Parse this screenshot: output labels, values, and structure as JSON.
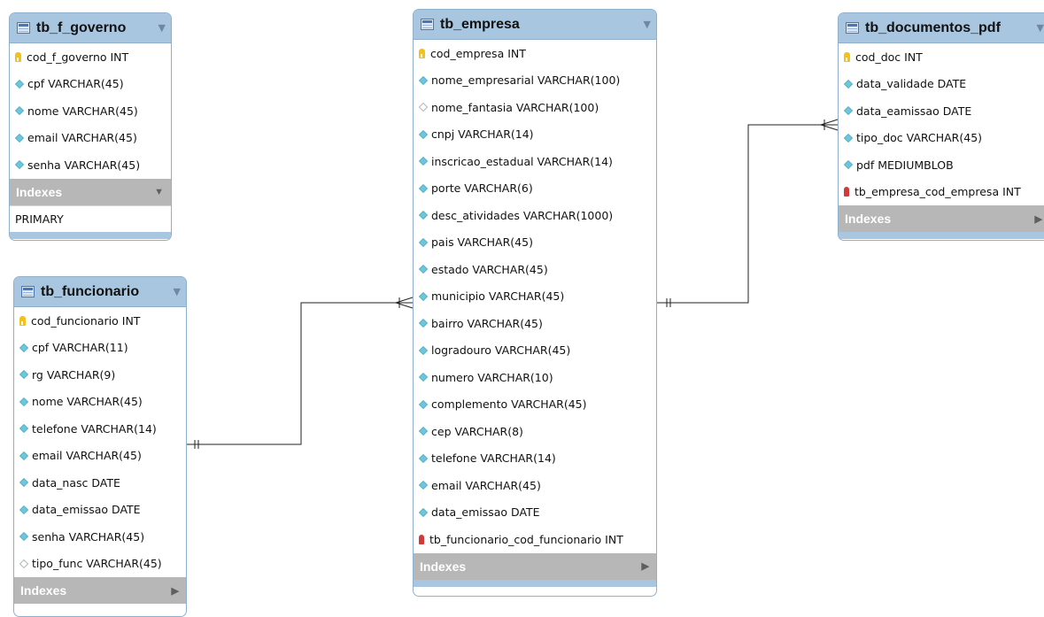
{
  "tables": {
    "tb_f_governo": {
      "title": "tb_f_governo",
      "columns": [
        {
          "label": "cod_f_governo INT",
          "icon": "primary-key-icon"
        },
        {
          "label": "cpf VARCHAR(45)",
          "icon": "diamond-filled-icon"
        },
        {
          "label": "nome VARCHAR(45)",
          "icon": "diamond-filled-icon"
        },
        {
          "label": "email VARCHAR(45)",
          "icon": "diamond-filled-icon"
        },
        {
          "label": "senha VARCHAR(45)",
          "icon": "diamond-filled-icon"
        }
      ],
      "indexes_label": "Indexes",
      "indexes": [
        "PRIMARY"
      ]
    },
    "tb_funcionario": {
      "title": "tb_funcionario",
      "columns": [
        {
          "label": "cod_funcionario INT",
          "icon": "primary-key-icon"
        },
        {
          "label": "cpf VARCHAR(11)",
          "icon": "diamond-filled-icon"
        },
        {
          "label": "rg VARCHAR(9)",
          "icon": "diamond-filled-icon"
        },
        {
          "label": "nome VARCHAR(45)",
          "icon": "diamond-filled-icon"
        },
        {
          "label": "telefone VARCHAR(14)",
          "icon": "diamond-filled-icon"
        },
        {
          "label": "email VARCHAR(45)",
          "icon": "diamond-filled-icon"
        },
        {
          "label": "data_nasc DATE",
          "icon": "diamond-filled-icon"
        },
        {
          "label": "data_emissao DATE",
          "icon": "diamond-filled-icon"
        },
        {
          "label": "senha VARCHAR(45)",
          "icon": "diamond-filled-icon"
        },
        {
          "label": "tipo_func VARCHAR(45)",
          "icon": "diamond-empty-icon"
        }
      ],
      "indexes_label": "Indexes"
    },
    "tb_empresa": {
      "title": "tb_empresa",
      "columns": [
        {
          "label": "cod_empresa INT",
          "icon": "primary-key-icon"
        },
        {
          "label": "nome_empresarial VARCHAR(100)",
          "icon": "diamond-filled-icon"
        },
        {
          "label": "nome_fantasia VARCHAR(100)",
          "icon": "diamond-empty-icon"
        },
        {
          "label": "cnpj VARCHAR(14)",
          "icon": "diamond-filled-icon"
        },
        {
          "label": "inscricao_estadual VARCHAR(14)",
          "icon": "diamond-filled-icon"
        },
        {
          "label": "porte VARCHAR(6)",
          "icon": "diamond-filled-icon"
        },
        {
          "label": "desc_atividades VARCHAR(1000)",
          "icon": "diamond-filled-icon"
        },
        {
          "label": "pais VARCHAR(45)",
          "icon": "diamond-filled-icon"
        },
        {
          "label": "estado VARCHAR(45)",
          "icon": "diamond-filled-icon"
        },
        {
          "label": "municipio VARCHAR(45)",
          "icon": "diamond-filled-icon"
        },
        {
          "label": "bairro VARCHAR(45)",
          "icon": "diamond-filled-icon"
        },
        {
          "label": "logradouro VARCHAR(45)",
          "icon": "diamond-filled-icon"
        },
        {
          "label": "numero VARCHAR(10)",
          "icon": "diamond-filled-icon"
        },
        {
          "label": "complemento VARCHAR(45)",
          "icon": "diamond-filled-icon"
        },
        {
          "label": "cep VARCHAR(8)",
          "icon": "diamond-filled-icon"
        },
        {
          "label": "telefone VARCHAR(14)",
          "icon": "diamond-filled-icon"
        },
        {
          "label": "email VARCHAR(45)",
          "icon": "diamond-filled-icon"
        },
        {
          "label": "data_emissao DATE",
          "icon": "diamond-filled-icon"
        },
        {
          "label": "tb_funcionario_cod_funcionario INT",
          "icon": "foreign-key-icon"
        }
      ],
      "indexes_label": "Indexes"
    },
    "tb_documentos_pdf": {
      "title": "tb_documentos_pdf",
      "columns": [
        {
          "label": "cod_doc INT",
          "icon": "primary-key-icon"
        },
        {
          "label": "data_validade DATE",
          "icon": "diamond-filled-icon"
        },
        {
          "label": "data_eamissao DATE",
          "icon": "diamond-filled-icon"
        },
        {
          "label": "tipo_doc VARCHAR(45)",
          "icon": "diamond-filled-icon"
        },
        {
          "label": "pdf MEDIUMBLOB",
          "icon": "diamond-filled-icon"
        },
        {
          "label": "tb_empresa_cod_empresa INT",
          "icon": "foreign-key-icon"
        }
      ],
      "indexes_label": "Indexes"
    }
  },
  "colors": {
    "header": "#a8c6e0",
    "border": "#8fb0cc",
    "indexes_bar": "#b7b7b7",
    "diamond": "#6cc7dc",
    "key": "#f2c21b",
    "foreign_key": "#d23a3a",
    "connector": "#222222"
  }
}
